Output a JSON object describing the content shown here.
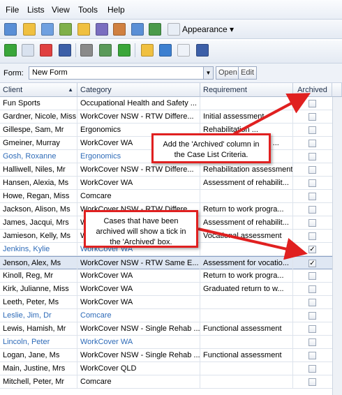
{
  "menu": [
    "File",
    "Lists",
    "View",
    "Tools",
    "Help"
  ],
  "toolbar1": {
    "appearance_label": "Appearance ▾"
  },
  "form": {
    "label": "Form:",
    "value": "New Form",
    "open_label": "Open",
    "edit_label": "Edit"
  },
  "columns": {
    "client": "Client",
    "category": "Category",
    "requirement": "Requirement",
    "archived": "Archived"
  },
  "rows": [
    {
      "client": "Fun Sports",
      "category": "Occupational Health and Safety ...",
      "requirement": "",
      "archived": false,
      "blue": false
    },
    {
      "client": "Gardner, Nicole, Miss",
      "category": "WorkCover NSW - RTW Differe...",
      "requirement": "Initial assessment",
      "archived": false,
      "blue": false
    },
    {
      "client": "Gillespe, Sam, Mr",
      "category": "Ergonomics",
      "requirement": "Rehabilitation ...",
      "archived": false,
      "blue": false
    },
    {
      "client": "Gmeiner, Murray",
      "category": "WorkCover WA",
      "requirement": "Return to work ... rn ...",
      "archived": false,
      "blue": false
    },
    {
      "client": "Gosh, Roxanne",
      "category": "Ergonomics",
      "requirement": "",
      "archived": false,
      "blue": true
    },
    {
      "client": "Halliwell, Niles, Mr",
      "category": "WorkCover NSW - RTW Differe...",
      "requirement": "Rehabilitation assessment",
      "archived": false,
      "blue": false
    },
    {
      "client": "Hansen, Alexia, Ms",
      "category": "WorkCover WA",
      "requirement": "Assessment of rehabilit...",
      "archived": false,
      "blue": false
    },
    {
      "client": "Howe, Regan, Miss",
      "category": "Comcare",
      "requirement": "",
      "archived": false,
      "blue": false
    },
    {
      "client": "Jackson, Alison, Ms",
      "category": "WorkCover NSW - RTW Differe...",
      "requirement": "Return to work progra...",
      "archived": false,
      "blue": false
    },
    {
      "client": "James, Jacqui, Mrs",
      "category": "WorkCover WA",
      "requirement": "Assessment of rehabilit...",
      "archived": false,
      "blue": false
    },
    {
      "client": "Jamieson, Kelly, Ms",
      "category": "WorkCover NSW - RTW Differe...",
      "requirement": "Vocational assessment",
      "archived": false,
      "blue": false
    },
    {
      "client": "Jenkins, Kylie",
      "category": "WorkCover WA",
      "requirement": "",
      "archived": true,
      "blue": true
    },
    {
      "client": "Jenson, Alex, Ms",
      "category": "WorkCover NSW - RTW Same E...",
      "requirement": "Assessment for vocatio...",
      "archived": true,
      "blue": false,
      "selected": true
    },
    {
      "client": "Kinoll, Reg, Mr",
      "category": "WorkCover WA",
      "requirement": "Return to work progra...",
      "archived": false,
      "blue": false
    },
    {
      "client": "Kirk, Julianne, Miss",
      "category": "WorkCover WA",
      "requirement": "Graduated return to w...",
      "archived": false,
      "blue": false
    },
    {
      "client": "Leeth, Peter, Ms",
      "category": "WorkCover WA",
      "requirement": "",
      "archived": false,
      "blue": false
    },
    {
      "client": "Leslie, Jim, Dr",
      "category": "Comcare",
      "requirement": "",
      "archived": false,
      "blue": true
    },
    {
      "client": "Lewis, Hamish, Mr",
      "category": "WorkCover NSW - Single Rehab ...",
      "requirement": "Functional assessment",
      "archived": false,
      "blue": false
    },
    {
      "client": "Lincoln, Peter",
      "category": "WorkCover WA",
      "requirement": "",
      "archived": false,
      "blue": true
    },
    {
      "client": "Logan, Jane, Ms",
      "category": "WorkCover NSW - Single Rehab ...",
      "requirement": "Functional assessment",
      "archived": false,
      "blue": false
    },
    {
      "client": "Main, Justine, Mrs",
      "category": "WorkCover QLD",
      "requirement": "",
      "archived": false,
      "blue": false
    },
    {
      "client": "Mitchell, Peter, Mr",
      "category": "Comcare",
      "requirement": "",
      "archived": false,
      "blue": false
    }
  ],
  "callouts": {
    "archived_column": "Add the 'Archived' column in the Case List Criteria.",
    "archived_tick": "Cases that have been archived will show a tick in the 'Archived' box."
  },
  "colors": {
    "arrow": "#e02020",
    "link_blue": "#2e6bb8"
  }
}
